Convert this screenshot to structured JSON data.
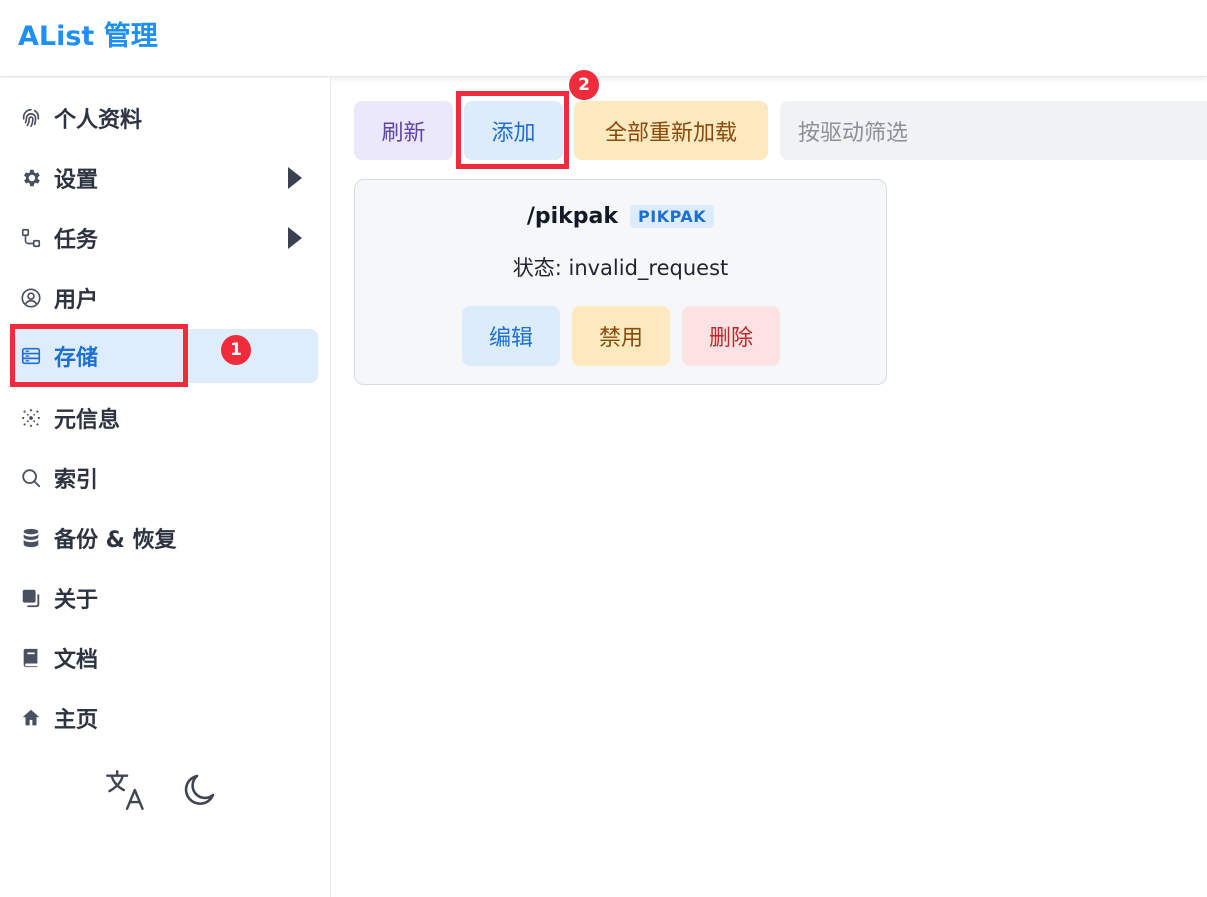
{
  "header": {
    "title": "AList 管理"
  },
  "sidebar": {
    "items": [
      {
        "label": "个人资料",
        "icon": "fingerprint-icon"
      },
      {
        "label": "设置",
        "icon": "gear-icon"
      },
      {
        "label": "任务",
        "icon": "flow-icon"
      },
      {
        "label": "用户",
        "icon": "user-circle-icon"
      },
      {
        "label": "存储",
        "icon": "storage-icon",
        "active": true
      },
      {
        "label": "元信息",
        "icon": "meta-icon"
      },
      {
        "label": "索引",
        "icon": "search-icon"
      },
      {
        "label": "备份 & 恢复",
        "icon": "database-icon"
      },
      {
        "label": "关于",
        "icon": "copy-icon"
      },
      {
        "label": "文档",
        "icon": "book-icon"
      },
      {
        "label": "主页",
        "icon": "home-icon"
      }
    ]
  },
  "bottom": {
    "icons": [
      "translate-icon",
      "moon-icon"
    ]
  },
  "toolbar": {
    "refresh_label": "刷新",
    "add_label": "添加",
    "reload_all_label": "全部重新加载",
    "filter_placeholder": "按驱动筛选"
  },
  "storage_card": {
    "path": "/pikpak",
    "driver_badge": "PIKPAK",
    "status_label": "状态:",
    "status_value": "invalid_request",
    "edit_label": "编辑",
    "disable_label": "禁用",
    "delete_label": "删除"
  },
  "annotations": {
    "badge_1": "1",
    "badge_2": "2"
  },
  "colors": {
    "brand": "#1e8ff5",
    "active_bg": "#deedfb",
    "annotation_red": "#ef2b3c"
  }
}
